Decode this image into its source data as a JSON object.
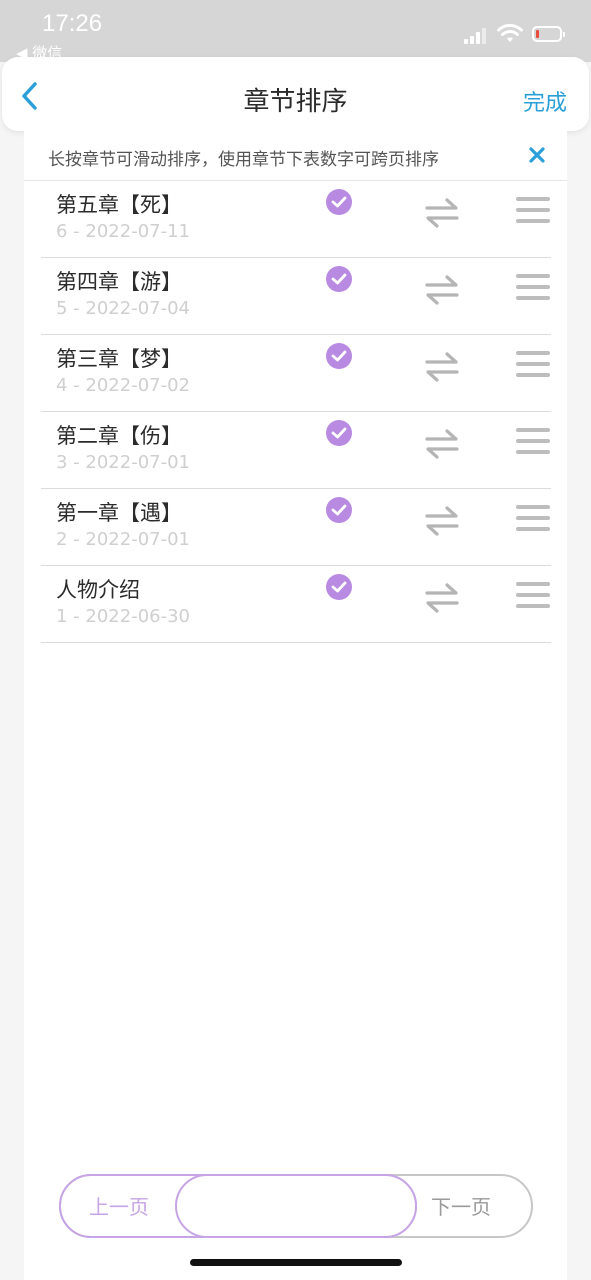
{
  "status_bar": {
    "time": "17:26",
    "back_app": "◀ 微信"
  },
  "nav": {
    "title": "章节排序",
    "done_label": "完成"
  },
  "tip": {
    "text": "长按章节可滑动排序，使用章节下表数字可跨页排序"
  },
  "chapters": [
    {
      "title": "第五章【死】",
      "meta": "6 - 2022-07-11",
      "checked": true
    },
    {
      "title": "第四章【游】",
      "meta": "5 - 2022-07-04",
      "checked": true
    },
    {
      "title": "第三章【梦】",
      "meta": "4 - 2022-07-02",
      "checked": true
    },
    {
      "title": "第二章【伤】",
      "meta": "3 - 2022-07-01",
      "checked": true
    },
    {
      "title": "第一章【遇】",
      "meta": "2 - 2022-07-01",
      "checked": true
    },
    {
      "title": "人物介绍",
      "meta": "1 - 2022-06-30",
      "checked": true
    }
  ],
  "pager": {
    "prev_label": "上一页",
    "next_label": "下一页",
    "page_value": ""
  },
  "colors": {
    "accent": "#2a9fd8",
    "check": "#b98ae2",
    "pager_active": "#c6a4e6",
    "muted": "#cfcfcf"
  },
  "icons": {
    "back": "chevron-left-icon",
    "close": "close-icon",
    "check": "check-circle-icon",
    "move": "swap-arrows-icon",
    "drag": "drag-handle-icon"
  }
}
